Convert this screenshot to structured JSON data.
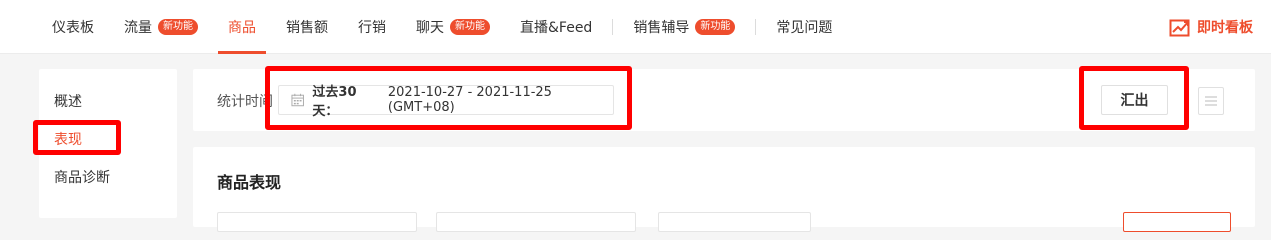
{
  "colors": {
    "accent": "#ee4d2d",
    "highlight": "#ff0000"
  },
  "nav": {
    "items": [
      {
        "label": "仪表板",
        "badge": ""
      },
      {
        "label": "流量",
        "badge": "新功能"
      },
      {
        "label": "商品",
        "badge": "",
        "active": true
      },
      {
        "label": "销售额",
        "badge": ""
      },
      {
        "label": "行销",
        "badge": ""
      },
      {
        "label": "聊天",
        "badge": "新功能"
      },
      {
        "label": "直播&Feed",
        "badge": ""
      },
      {
        "label": "销售辅导",
        "badge": "新功能"
      },
      {
        "label": "常见问题",
        "badge": ""
      }
    ],
    "realtime_label": "即时看板",
    "realtime_icon": "trend-chart-icon"
  },
  "sidebar": {
    "items": [
      {
        "label": "概述"
      },
      {
        "label": "表现",
        "active": true
      },
      {
        "label": "商品诊断"
      }
    ]
  },
  "filter": {
    "label": "统计时间",
    "date_prefix": "过去30 天：",
    "date_range": "2021-10-27 - 2021-11-25 (GMT+08)",
    "calendar_icon": "calendar-icon",
    "export_label": "汇出",
    "menu_icon": "menu-icon"
  },
  "content": {
    "title": "商品表现"
  }
}
